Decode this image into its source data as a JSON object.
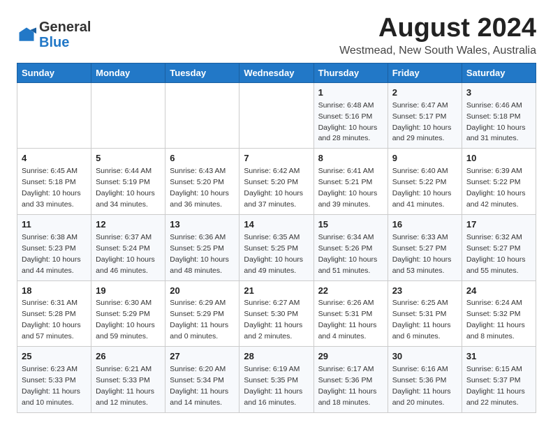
{
  "header": {
    "logo_general": "General",
    "logo_blue": "Blue",
    "title": "August 2024",
    "subtitle": "Westmead, New South Wales, Australia"
  },
  "calendar": {
    "days_of_week": [
      "Sunday",
      "Monday",
      "Tuesday",
      "Wednesday",
      "Thursday",
      "Friday",
      "Saturday"
    ],
    "weeks": [
      [
        {
          "day": "",
          "info": ""
        },
        {
          "day": "",
          "info": ""
        },
        {
          "day": "",
          "info": ""
        },
        {
          "day": "",
          "info": ""
        },
        {
          "day": "1",
          "info": "Sunrise: 6:48 AM\nSunset: 5:16 PM\nDaylight: 10 hours\nand 28 minutes."
        },
        {
          "day": "2",
          "info": "Sunrise: 6:47 AM\nSunset: 5:17 PM\nDaylight: 10 hours\nand 29 minutes."
        },
        {
          "day": "3",
          "info": "Sunrise: 6:46 AM\nSunset: 5:18 PM\nDaylight: 10 hours\nand 31 minutes."
        }
      ],
      [
        {
          "day": "4",
          "info": "Sunrise: 6:45 AM\nSunset: 5:18 PM\nDaylight: 10 hours\nand 33 minutes."
        },
        {
          "day": "5",
          "info": "Sunrise: 6:44 AM\nSunset: 5:19 PM\nDaylight: 10 hours\nand 34 minutes."
        },
        {
          "day": "6",
          "info": "Sunrise: 6:43 AM\nSunset: 5:20 PM\nDaylight: 10 hours\nand 36 minutes."
        },
        {
          "day": "7",
          "info": "Sunrise: 6:42 AM\nSunset: 5:20 PM\nDaylight: 10 hours\nand 37 minutes."
        },
        {
          "day": "8",
          "info": "Sunrise: 6:41 AM\nSunset: 5:21 PM\nDaylight: 10 hours\nand 39 minutes."
        },
        {
          "day": "9",
          "info": "Sunrise: 6:40 AM\nSunset: 5:22 PM\nDaylight: 10 hours\nand 41 minutes."
        },
        {
          "day": "10",
          "info": "Sunrise: 6:39 AM\nSunset: 5:22 PM\nDaylight: 10 hours\nand 42 minutes."
        }
      ],
      [
        {
          "day": "11",
          "info": "Sunrise: 6:38 AM\nSunset: 5:23 PM\nDaylight: 10 hours\nand 44 minutes."
        },
        {
          "day": "12",
          "info": "Sunrise: 6:37 AM\nSunset: 5:24 PM\nDaylight: 10 hours\nand 46 minutes."
        },
        {
          "day": "13",
          "info": "Sunrise: 6:36 AM\nSunset: 5:25 PM\nDaylight: 10 hours\nand 48 minutes."
        },
        {
          "day": "14",
          "info": "Sunrise: 6:35 AM\nSunset: 5:25 PM\nDaylight: 10 hours\nand 49 minutes."
        },
        {
          "day": "15",
          "info": "Sunrise: 6:34 AM\nSunset: 5:26 PM\nDaylight: 10 hours\nand 51 minutes."
        },
        {
          "day": "16",
          "info": "Sunrise: 6:33 AM\nSunset: 5:27 PM\nDaylight: 10 hours\nand 53 minutes."
        },
        {
          "day": "17",
          "info": "Sunrise: 6:32 AM\nSunset: 5:27 PM\nDaylight: 10 hours\nand 55 minutes."
        }
      ],
      [
        {
          "day": "18",
          "info": "Sunrise: 6:31 AM\nSunset: 5:28 PM\nDaylight: 10 hours\nand 57 minutes."
        },
        {
          "day": "19",
          "info": "Sunrise: 6:30 AM\nSunset: 5:29 PM\nDaylight: 10 hours\nand 59 minutes."
        },
        {
          "day": "20",
          "info": "Sunrise: 6:29 AM\nSunset: 5:29 PM\nDaylight: 11 hours\nand 0 minutes."
        },
        {
          "day": "21",
          "info": "Sunrise: 6:27 AM\nSunset: 5:30 PM\nDaylight: 11 hours\nand 2 minutes."
        },
        {
          "day": "22",
          "info": "Sunrise: 6:26 AM\nSunset: 5:31 PM\nDaylight: 11 hours\nand 4 minutes."
        },
        {
          "day": "23",
          "info": "Sunrise: 6:25 AM\nSunset: 5:31 PM\nDaylight: 11 hours\nand 6 minutes."
        },
        {
          "day": "24",
          "info": "Sunrise: 6:24 AM\nSunset: 5:32 PM\nDaylight: 11 hours\nand 8 minutes."
        }
      ],
      [
        {
          "day": "25",
          "info": "Sunrise: 6:23 AM\nSunset: 5:33 PM\nDaylight: 11 hours\nand 10 minutes."
        },
        {
          "day": "26",
          "info": "Sunrise: 6:21 AM\nSunset: 5:33 PM\nDaylight: 11 hours\nand 12 minutes."
        },
        {
          "day": "27",
          "info": "Sunrise: 6:20 AM\nSunset: 5:34 PM\nDaylight: 11 hours\nand 14 minutes."
        },
        {
          "day": "28",
          "info": "Sunrise: 6:19 AM\nSunset: 5:35 PM\nDaylight: 11 hours\nand 16 minutes."
        },
        {
          "day": "29",
          "info": "Sunrise: 6:17 AM\nSunset: 5:36 PM\nDaylight: 11 hours\nand 18 minutes."
        },
        {
          "day": "30",
          "info": "Sunrise: 6:16 AM\nSunset: 5:36 PM\nDaylight: 11 hours\nand 20 minutes."
        },
        {
          "day": "31",
          "info": "Sunrise: 6:15 AM\nSunset: 5:37 PM\nDaylight: 11 hours\nand 22 minutes."
        }
      ]
    ]
  }
}
